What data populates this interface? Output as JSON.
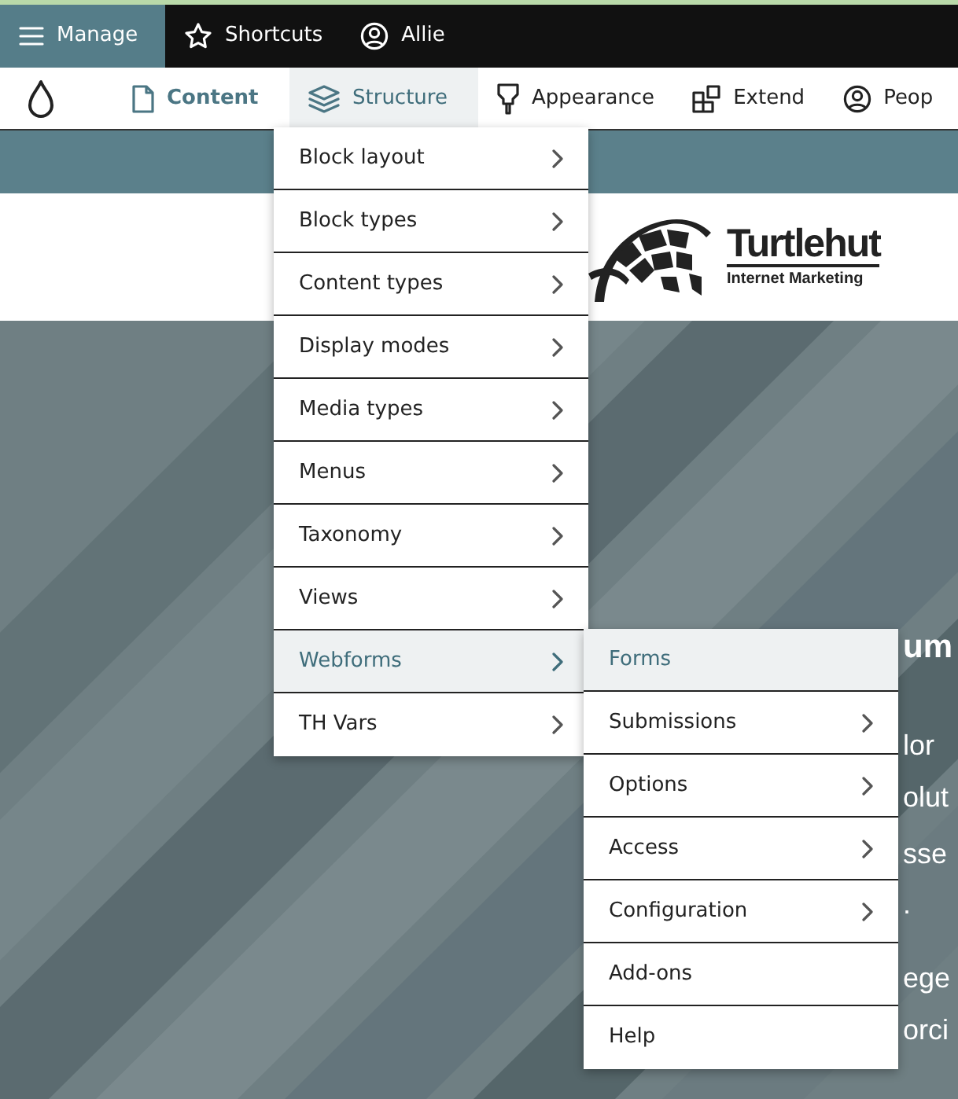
{
  "toolbar": {
    "items": [
      {
        "label": "Manage",
        "selected": true
      },
      {
        "label": "Shortcuts",
        "selected": false
      },
      {
        "label": "Allie",
        "selected": false
      }
    ]
  },
  "tray": {
    "items": [
      {
        "label": "Content",
        "selected": false,
        "current": true
      },
      {
        "label": "Structure",
        "selected": true,
        "current": false
      },
      {
        "label": "Appearance",
        "selected": false,
        "current": false
      },
      {
        "label": "Extend",
        "selected": false,
        "current": false
      },
      {
        "label": "Peop",
        "selected": false,
        "current": false
      }
    ]
  },
  "structure_menu": [
    {
      "label": "Block layout",
      "has_children": true,
      "selected": false
    },
    {
      "label": "Block types",
      "has_children": true,
      "selected": false
    },
    {
      "label": "Content types",
      "has_children": true,
      "selected": false
    },
    {
      "label": "Display modes",
      "has_children": true,
      "selected": false
    },
    {
      "label": "Media types",
      "has_children": true,
      "selected": false
    },
    {
      "label": "Menus",
      "has_children": true,
      "selected": false
    },
    {
      "label": "Taxonomy",
      "has_children": true,
      "selected": false
    },
    {
      "label": "Views",
      "has_children": true,
      "selected": false
    },
    {
      "label": "Webforms",
      "has_children": true,
      "selected": true
    },
    {
      "label": "TH Vars",
      "has_children": true,
      "selected": false
    }
  ],
  "webforms_menu": [
    {
      "label": "Forms",
      "has_children": false,
      "selected": true
    },
    {
      "label": "Submissions",
      "has_children": true,
      "selected": false
    },
    {
      "label": "Options",
      "has_children": true,
      "selected": false
    },
    {
      "label": "Access",
      "has_children": true,
      "selected": false
    },
    {
      "label": "Configuration",
      "has_children": true,
      "selected": false
    },
    {
      "label": "Add-ons",
      "has_children": false,
      "selected": false
    },
    {
      "label": "Help",
      "has_children": false,
      "selected": false
    }
  ],
  "logo": {
    "name": "Turtlehut",
    "tagline": "Internet Marketing"
  },
  "hero": {
    "heading": "um",
    "lines": [
      "lor",
      "olut",
      "sse",
      ".",
      "ege",
      "orci"
    ]
  }
}
